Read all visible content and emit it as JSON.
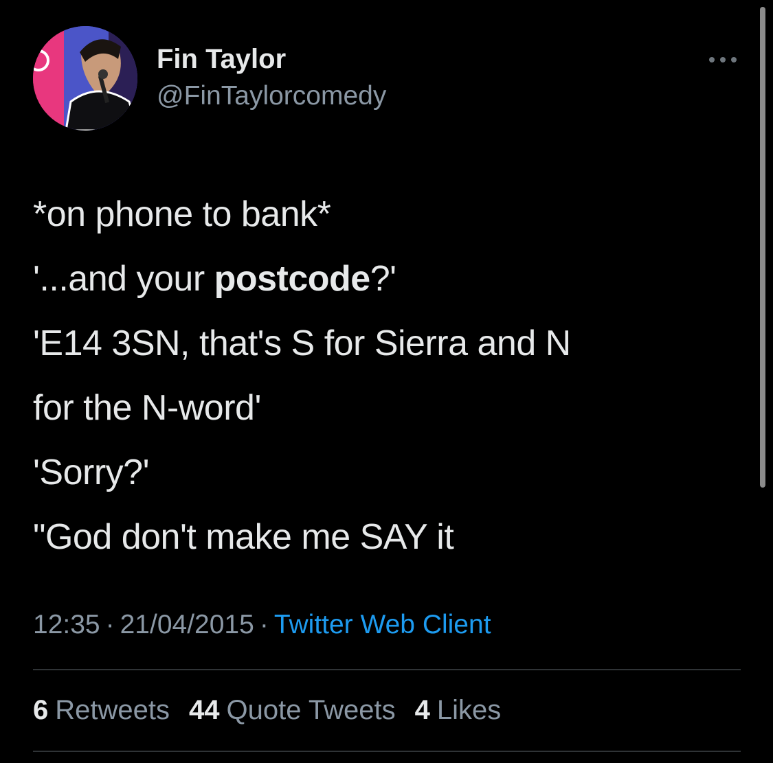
{
  "author": {
    "display_name": "Fin Taylor",
    "handle": "@FinTaylorcomedy",
    "avatar_icon": "avatar-photo"
  },
  "tweet": {
    "line1": "*on phone to bank*",
    "line2_before": "'...and your ",
    "line2_bold": "postcode",
    "line2_after": "?'",
    "line3": "'E14 3SN, that's S for Sierra and N",
    "line4": "for the N-word'",
    "line5": "'Sorry?'",
    "line6": "\"God don't make me SAY it"
  },
  "meta": {
    "time": "12:35",
    "separator": "·",
    "date": "21/04/2015",
    "source": "Twitter Web Client"
  },
  "stats": {
    "retweets_count": "6",
    "retweets_label": "Retweets",
    "quotes_count": "44",
    "quotes_label": "Quote Tweets",
    "likes_count": "4",
    "likes_label": "Likes"
  },
  "colors": {
    "background": "#000000",
    "text": "#e7e9ea",
    "secondary": "#8b98a5",
    "link": "#1d9bf0",
    "divider": "#2f3336"
  }
}
